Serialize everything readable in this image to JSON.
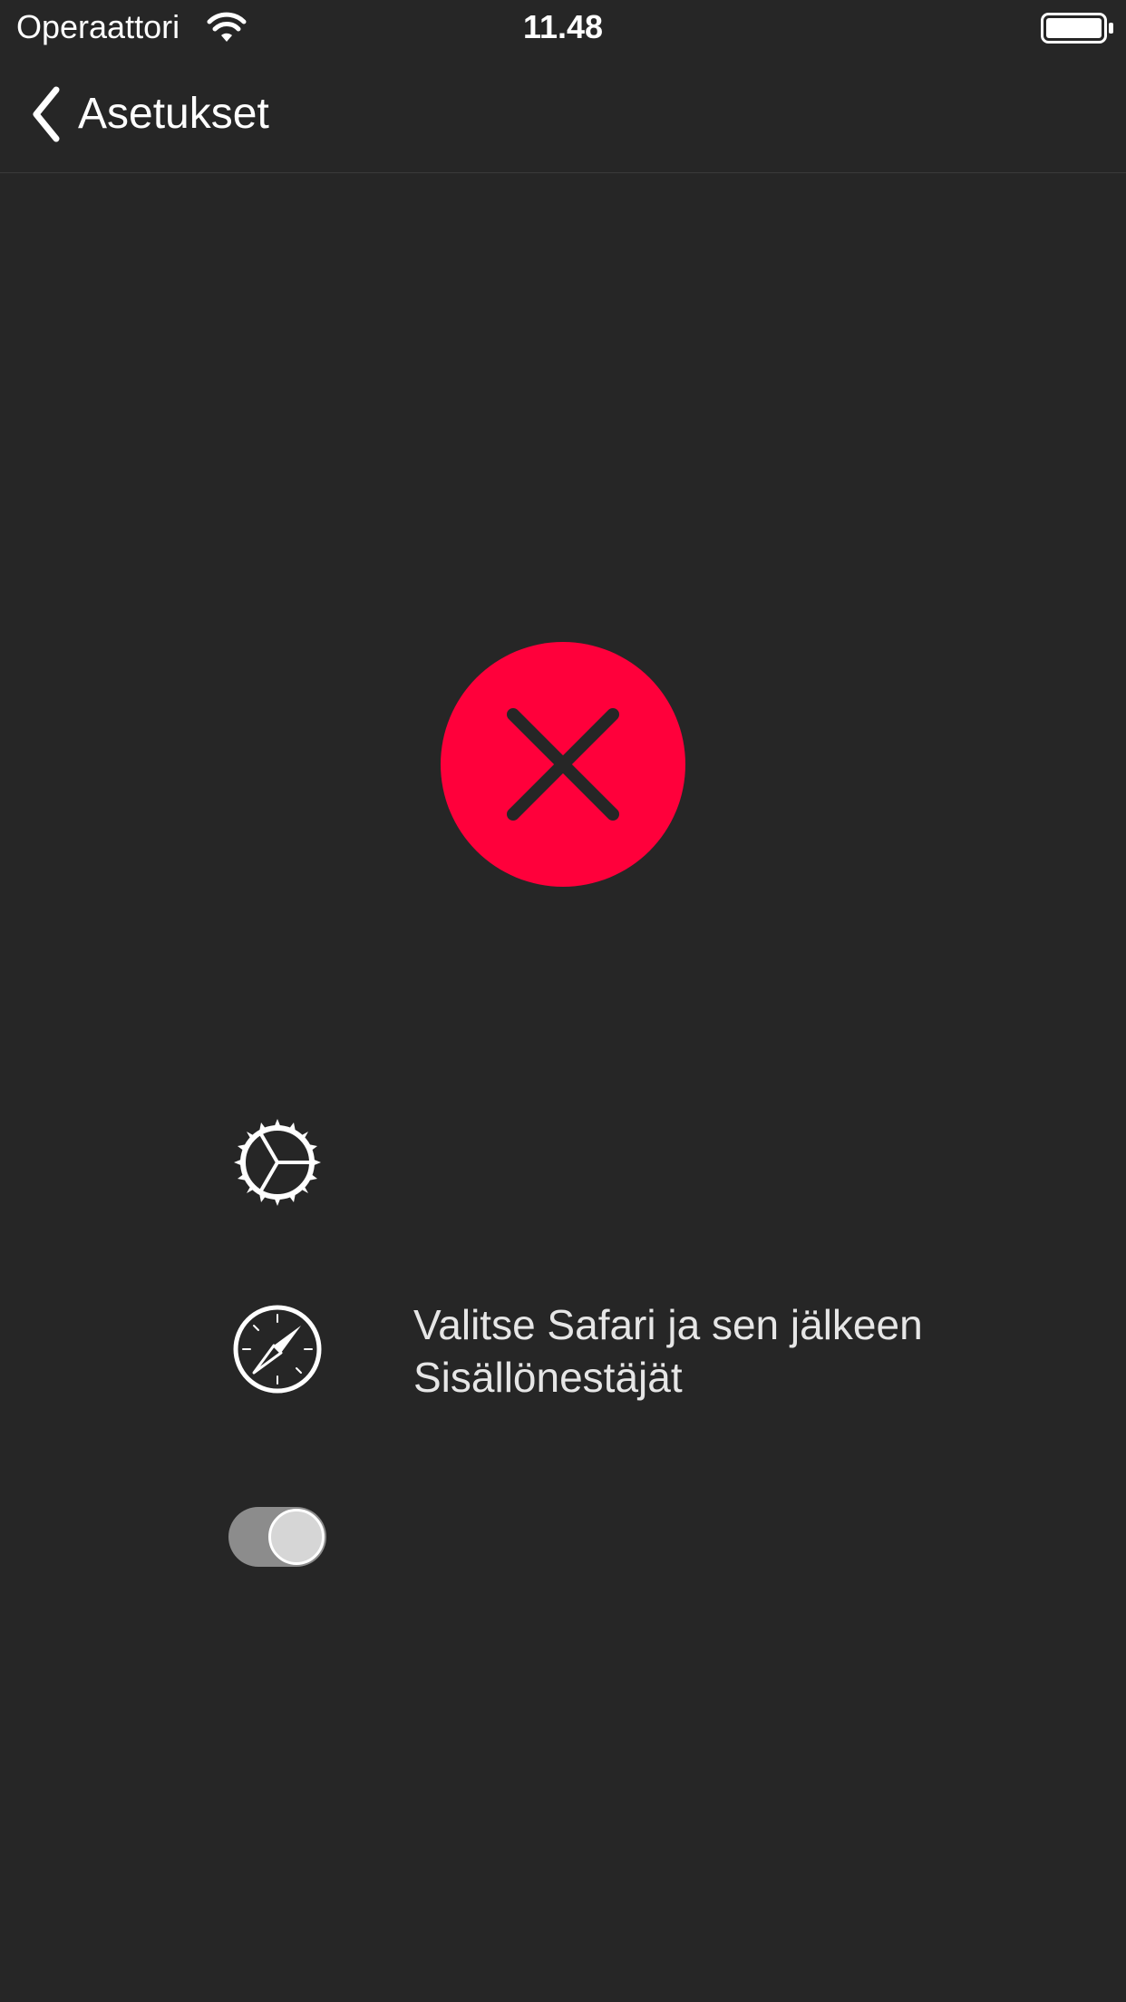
{
  "status_bar": {
    "carrier": "Operaattori",
    "time": "11.48",
    "wifi_icon": "wifi-icon",
    "battery_icon": "battery-full-icon"
  },
  "nav": {
    "back_label": "Asetukset",
    "back_icon": "chevron-left-icon"
  },
  "status": {
    "icon": "close-icon",
    "color": "#ff003b"
  },
  "steps": [
    {
      "icon": "gear-icon",
      "text": ""
    },
    {
      "icon": "compass-icon",
      "text": "Valitse Safari ja sen jälkeen Sisällönestäjät"
    },
    {
      "icon": "toggle-icon",
      "text": ""
    }
  ],
  "colors": {
    "background": "#262626",
    "accent": "#ff003b",
    "text": "#ffffff"
  }
}
